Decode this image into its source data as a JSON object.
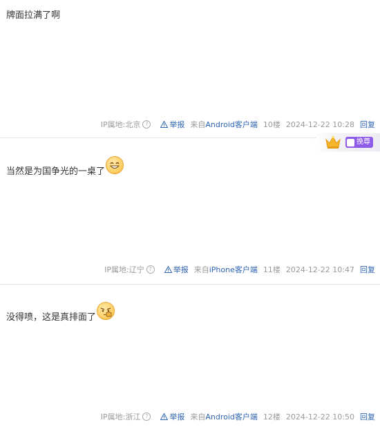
{
  "posts": [
    {
      "content": "牌面拉满了啊",
      "ip_location": "IP属地:北京",
      "report_label": "举报",
      "source_prefix": "来自",
      "client": "Android客户端",
      "floor": "10楼",
      "time": "2024-12-22 10:28",
      "reply_label": "回复"
    },
    {
      "content": "当然是为国争光的一桌了",
      "emoji": "grinning-face-emoji",
      "ip_location": "IP属地:辽宁",
      "report_label": "举报",
      "source_prefix": "来自",
      "client": "iPhone客户端",
      "floor": "11楼",
      "time": "2024-12-22 10:47",
      "reply_label": "回复",
      "badge_label": "挽尊"
    },
    {
      "content": "没得喷，这是真排面了",
      "emoji": "thumbs-up-face-emoji",
      "ip_location": "IP属地:浙江",
      "report_label": "举报",
      "source_prefix": "来自",
      "client": "Android客户端",
      "floor": "12楼",
      "time": "2024-12-22 10:50",
      "reply_label": "回复"
    }
  ],
  "colors": {
    "link": "#2d64b3",
    "meta": "#999999",
    "text": "#333333",
    "badge": "#8e5ce8"
  }
}
